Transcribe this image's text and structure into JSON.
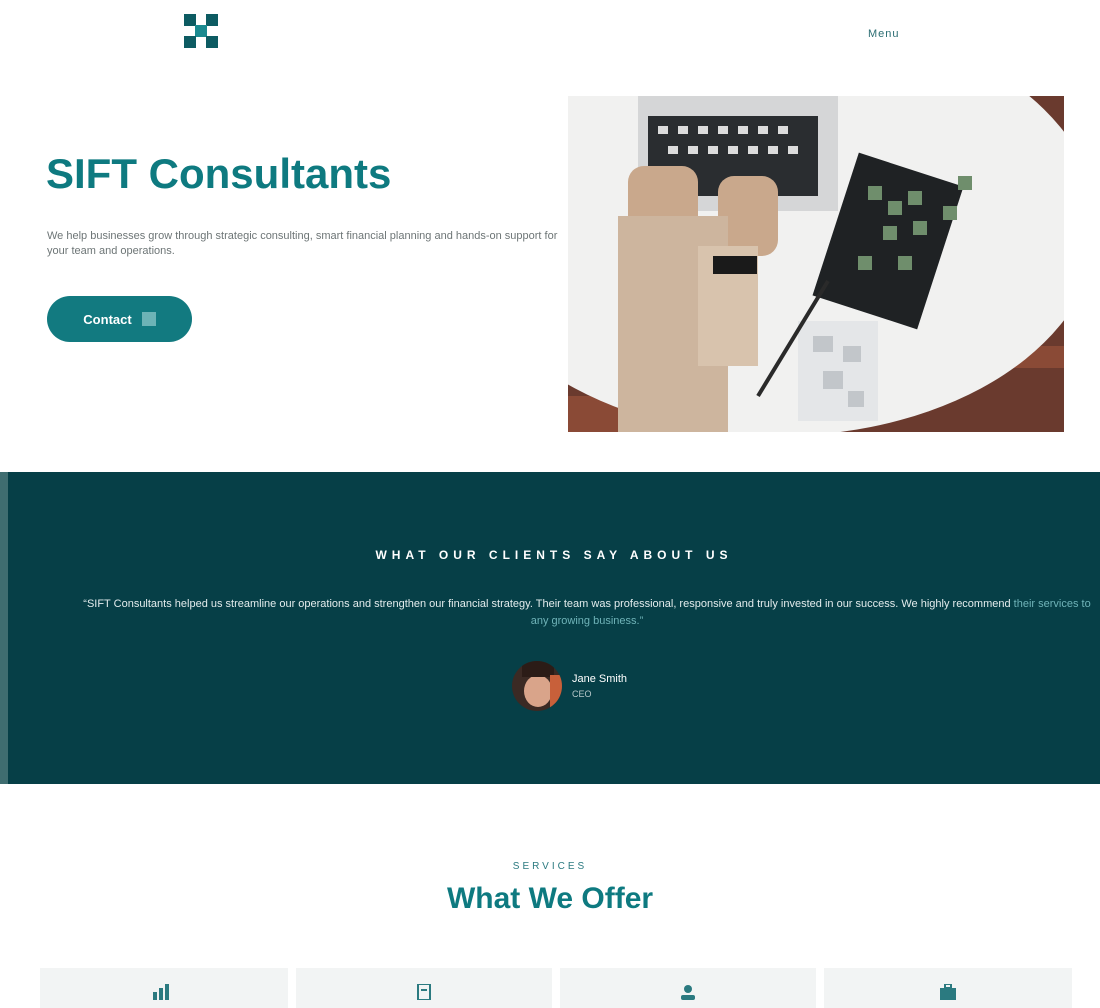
{
  "nav": {
    "logo_alt": "X",
    "link": "Menu"
  },
  "hero": {
    "title": "SIFT Consultants",
    "description": "We help businesses grow through strategic consulting, smart financial planning and hands-on support for your team and operations.",
    "button_label": "Contact"
  },
  "testimonial": {
    "heading": "What our clients say about us",
    "quote_main": "“SIFT Consultants helped us streamline our operations and strengthen our financial strategy. Their team was professional, responsive and truly invested in our success. We highly recommend",
    "quote_highlight": "their services to any growing business.”",
    "author_name": "Jane Smith",
    "author_role": "CEO"
  },
  "services": {
    "eyebrow": "SERVICES",
    "title": "What We Offer",
    "cards": [
      {
        "icon": "chart-icon"
      },
      {
        "icon": "document-icon"
      },
      {
        "icon": "people-icon"
      },
      {
        "icon": "briefcase-icon"
      }
    ]
  },
  "colors": {
    "accent": "#0e7a80",
    "dark_band": "#063f47"
  }
}
